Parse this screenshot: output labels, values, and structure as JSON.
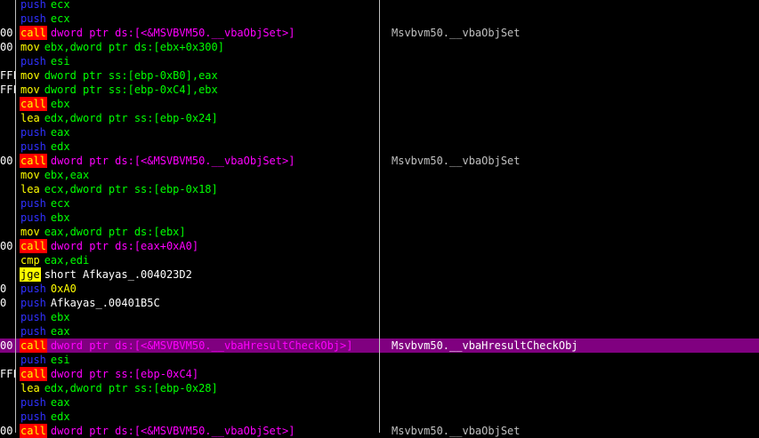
{
  "rows": [
    {
      "addr": "",
      "mn": "push",
      "ops": "ecx",
      "cmt": "",
      "kind": "push"
    },
    {
      "addr": "",
      "mn": "push",
      "ops": "ecx",
      "cmt": "",
      "kind": "push"
    },
    {
      "addr": "00",
      "mn": "call",
      "ops": "dword ptr ds:[<&MSVBVM50.__vbaObjSet>]",
      "cmt": "Msvbvm50.__vbaObjSet",
      "kind": "call"
    },
    {
      "addr": "00",
      "mn": "mov",
      "ops": "ebx,dword ptr ds:[ebx+0x300]",
      "cmt": "",
      "kind": "mov"
    },
    {
      "addr": "",
      "mn": "push",
      "ops": "esi",
      "cmt": "",
      "kind": "push"
    },
    {
      "addr": "FFF",
      "mn": "mov",
      "ops": "dword ptr ss:[ebp-0xB0],eax",
      "cmt": "",
      "kind": "mov"
    },
    {
      "addr": "FFF",
      "mn": "mov",
      "ops": "dword ptr ss:[ebp-0xC4],ebx",
      "cmt": "",
      "kind": "mov"
    },
    {
      "addr": "",
      "mn": "call",
      "ops": "ebx",
      "cmt": "",
      "kind": "call",
      "ops_class": "o-push"
    },
    {
      "addr": "",
      "mn": "lea",
      "ops": "edx,dword ptr ss:[ebp-0x24]",
      "cmt": "",
      "kind": "lea"
    },
    {
      "addr": "",
      "mn": "push",
      "ops": "eax",
      "cmt": "",
      "kind": "push"
    },
    {
      "addr": "",
      "mn": "push",
      "ops": "edx",
      "cmt": "",
      "kind": "push"
    },
    {
      "addr": "00",
      "mn": "call",
      "ops": "dword ptr ds:[<&MSVBVM50.__vbaObjSet>]",
      "cmt": "Msvbvm50.__vbaObjSet",
      "kind": "call"
    },
    {
      "addr": "",
      "mn": "mov",
      "ops": "ebx,eax",
      "cmt": "",
      "kind": "mov"
    },
    {
      "addr": "",
      "mn": "lea",
      "ops": "ecx,dword ptr ss:[ebp-0x18]",
      "cmt": "",
      "kind": "lea"
    },
    {
      "addr": "",
      "mn": "push",
      "ops": "ecx",
      "cmt": "",
      "kind": "push"
    },
    {
      "addr": "",
      "mn": "push",
      "ops": "ebx",
      "cmt": "",
      "kind": "push"
    },
    {
      "addr": "",
      "mn": "mov",
      "ops": "eax,dword ptr ds:[ebx]",
      "cmt": "",
      "kind": "mov"
    },
    {
      "addr": "00",
      "mn": "call",
      "ops": "dword ptr ds:[eax+0xA0]",
      "cmt": "",
      "kind": "call"
    },
    {
      "addr": "",
      "mn": "cmp",
      "ops": "eax,edi",
      "cmt": "",
      "kind": "cmp"
    },
    {
      "addr": "",
      "mn": "jge",
      "ops": "short Afkayas_.004023D2",
      "cmt": "",
      "kind": "jge"
    },
    {
      "addr": "0",
      "mn": "push",
      "ops": "0xA0",
      "cmt": "",
      "kind": "push",
      "ops_class": "o-imm"
    },
    {
      "addr": "0",
      "mn": "push",
      "ops": "Afkayas_.00401B5C",
      "cmt": "",
      "kind": "push",
      "ops_class": "o-label"
    },
    {
      "addr": "",
      "mn": "push",
      "ops": "ebx",
      "cmt": "",
      "kind": "push"
    },
    {
      "addr": "",
      "mn": "push",
      "ops": "eax",
      "cmt": "",
      "kind": "push"
    },
    {
      "addr": "00",
      "mn": "call",
      "ops": "dword ptr ds:[<&MSVBVM50.__vbaHresultCheckObj>]",
      "cmt": "Msvbvm50.__vbaHresultCheckObj",
      "kind": "call",
      "selected": true
    },
    {
      "addr": "",
      "mn": "push",
      "ops": "esi",
      "cmt": "",
      "kind": "push"
    },
    {
      "addr": "FFF",
      "mn": "call",
      "ops": "dword ptr ss:[ebp-0xC4]",
      "cmt": "",
      "kind": "call"
    },
    {
      "addr": "",
      "mn": "lea",
      "ops": "edx,dword ptr ss:[ebp-0x28]",
      "cmt": "",
      "kind": "lea"
    },
    {
      "addr": "",
      "mn": "push",
      "ops": "eax",
      "cmt": "",
      "kind": "push"
    },
    {
      "addr": "",
      "mn": "push",
      "ops": "edx",
      "cmt": "",
      "kind": "push"
    },
    {
      "addr": "00",
      "mn": "call",
      "ops": "dword ptr ds:[<&MSVBVM50.__vbaObjSet>]",
      "cmt": "Msvbvm50.__vbaObjSet",
      "kind": "call"
    }
  ],
  "colors": {
    "background": "#000000",
    "selection": "#800080",
    "call_bg": "#ff0000",
    "jump_bg": "#ffff00",
    "push_text": "#3030ff",
    "operand_text": "#00ff00",
    "call_operand_text": "#ff00ff"
  }
}
